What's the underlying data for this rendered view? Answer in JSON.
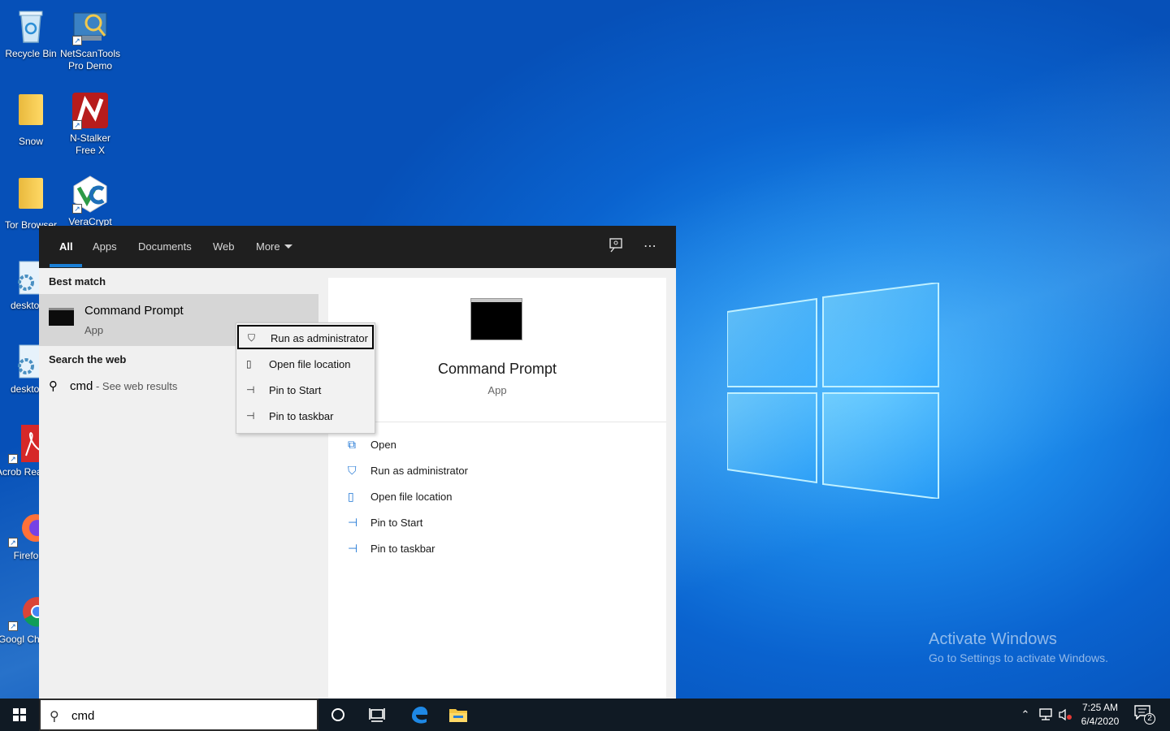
{
  "desktop": {
    "icons": [
      {
        "label": "Recycle Bin"
      },
      {
        "label": "NetScanTools Pro Demo"
      },
      {
        "label": "Snow"
      },
      {
        "label": "N-Stalker Free X"
      },
      {
        "label": "Tor Browser"
      },
      {
        "label": "VeraCrypt"
      },
      {
        "label": "desktop"
      },
      {
        "label": "desktop"
      },
      {
        "label": "Acrob Reader"
      },
      {
        "label": "Firefo"
      },
      {
        "label": "Googl Chron"
      }
    ],
    "watermark": {
      "title": "Activate Windows",
      "subtitle": "Go to Settings to activate Windows."
    }
  },
  "search_panel": {
    "tabs": [
      "All",
      "Apps",
      "Documents",
      "Web",
      "More"
    ],
    "active_tab": "All",
    "best_match": {
      "header": "Best match",
      "title": "Command Prompt",
      "subtitle": "App"
    },
    "web": {
      "header": "Search the web",
      "query": "cmd",
      "hint": " - See web results"
    },
    "detail": {
      "title": "Command Prompt",
      "subtitle": "App",
      "actions": [
        "Open",
        "Run as administrator",
        "Open file location",
        "Pin to Start",
        "Pin to taskbar"
      ]
    },
    "context_menu": {
      "items": [
        "Run as administrator",
        "Open file location",
        "Pin to Start",
        "Pin to taskbar"
      ],
      "focused": "Run as administrator"
    }
  },
  "taskbar": {
    "search_value": "cmd",
    "time": "7:25 AM",
    "date": "6/4/2020",
    "notification_count": "2"
  }
}
